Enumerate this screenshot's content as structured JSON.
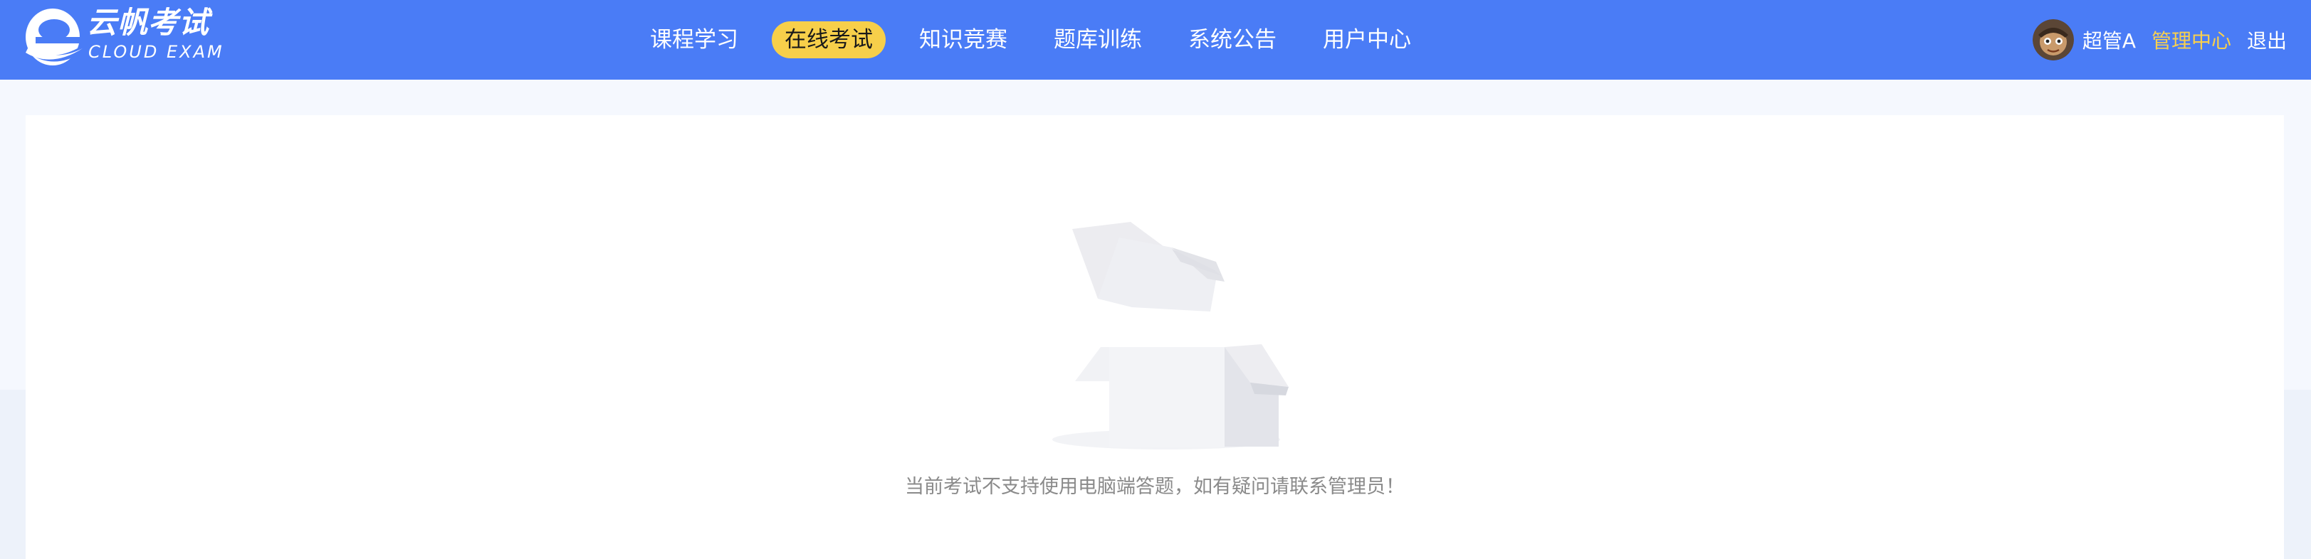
{
  "header": {
    "logo": {
      "title": "云帆考试",
      "subtitle": "CLOUD EXAM",
      "icon": "logo-e-icon"
    },
    "nav": [
      {
        "label": "课程学习",
        "active": false
      },
      {
        "label": "在线考试",
        "active": true
      },
      {
        "label": "知识竞赛",
        "active": false
      },
      {
        "label": "题库训练",
        "active": false
      },
      {
        "label": "系统公告",
        "active": false
      },
      {
        "label": "用户中心",
        "active": false
      }
    ],
    "user": {
      "avatar_icon": "user-avatar-icon",
      "name": "超管A",
      "admin_label": "管理中心",
      "logout_label": "退出"
    }
  },
  "main": {
    "empty_state": {
      "icon": "empty-box-icon",
      "message": "当前考试不支持使用电脑端答题，如有疑问请联系管理员！"
    }
  },
  "colors": {
    "header_bg": "#4a7cf6",
    "active_nav_bg": "#f7cf4a",
    "admin_link": "#f9d04d",
    "page_bg": "#f5f8fe",
    "card_bg": "#ffffff",
    "empty_text": "#8a8a8a"
  }
}
